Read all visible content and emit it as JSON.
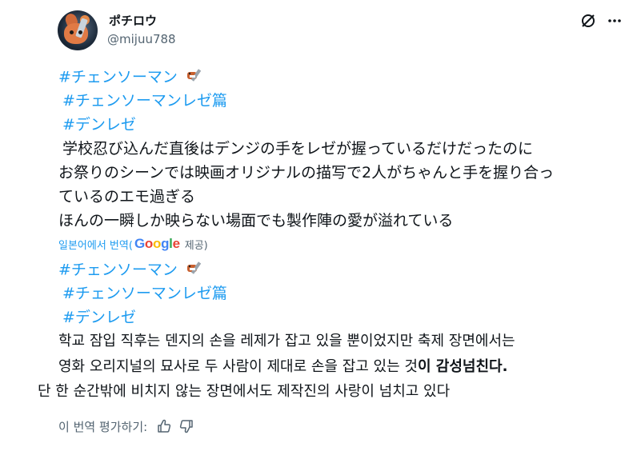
{
  "user": {
    "display_name": "ポチロウ",
    "handle": "@mijuu788"
  },
  "header_icons": [
    "grok-icon",
    "more-icon"
  ],
  "original": {
    "tags": [
      "#チェンソーマン",
      "#チェンソーマンレゼ篇",
      "#デンレゼ"
    ],
    "lines": [
      "学校忍び込んだ直後はデンジの手をレゼが握っているだけだったのに",
      "お祭りのシーンでは映画オリジナルの描写で2人がちゃんと手を握り合っ",
      "ているのエモ過ぎる",
      "ほんの一瞬しか映らない場面でも製作陣の愛が溢れている"
    ]
  },
  "translation_credit": {
    "label": "일본어에서 번역(",
    "provider": "Google",
    "suffix": "제공)"
  },
  "translated": {
    "tags": [
      "#チェンソーマン",
      "#チェンソーマンレゼ篇",
      "#デンレゼ"
    ],
    "line1": "학교 잠입 직후는 덴지의 손을 레제가 잡고 있을 뿐이었지만 축제 장면에서는",
    "line2_normal": "영화 오리지널의 묘사로 두 사람이 제대로 손을 잡고 있는 것",
    "line2_bold": "이 감성넘친다.",
    "line3": "단 한 순간밖에 비치지 않는 장면에서도 제작진의 사랑이 넘치고 있다"
  },
  "rate": {
    "label": "이 번역 평가하기:"
  },
  "colors": {
    "link": "#1d9bf0",
    "text": "#0f1419",
    "muted": "#536471"
  }
}
